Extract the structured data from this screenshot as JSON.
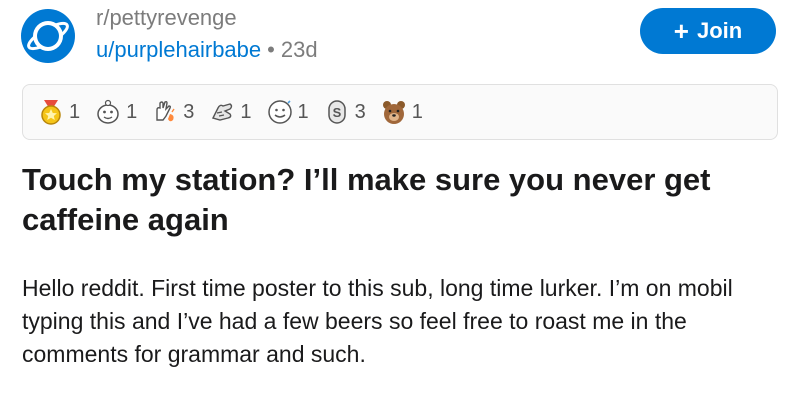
{
  "post": {
    "subreddit": "r/pettyrevenge",
    "username": "u/purplehairbabe",
    "separator": "•",
    "age": "23d",
    "join_label": "Join",
    "join_icon": "plus-icon",
    "title": "Touch my station? I’ll make sure you never get caffeine again",
    "body": "Hello reddit. First time poster to this sub, long time lurker. I’m on mobil typing this and I’ve had a few beers so feel free to roast me in the comments for grammar and such."
  },
  "awards": [
    {
      "icon": "gold-medal-award-icon",
      "count": "1"
    },
    {
      "icon": "wholesome-award-icon",
      "count": "1"
    },
    {
      "icon": "helpful-hand-award-icon",
      "count": "3"
    },
    {
      "icon": "hugz-award-icon",
      "count": "1"
    },
    {
      "icon": "silver-smile-award-icon",
      "count": "1"
    },
    {
      "icon": "silver-coin-award-icon",
      "count": "3"
    },
    {
      "icon": "bear-award-icon",
      "count": "1"
    }
  ],
  "colors": {
    "accent": "#0079d3",
    "muted_text": "#7c7c7c",
    "text": "#1a1a1b"
  }
}
